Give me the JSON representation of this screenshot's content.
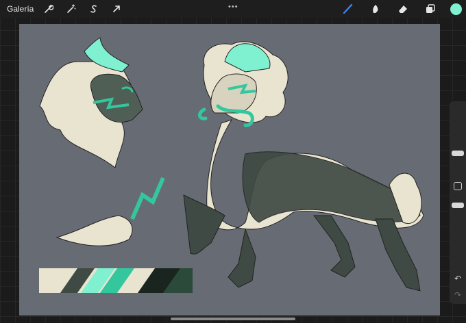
{
  "topbar": {
    "gallery_label": "Galería",
    "left_tools": [
      {
        "icon": "wrench-icon"
      },
      {
        "icon": "magic-wand-icon"
      },
      {
        "icon": "selection-s-icon"
      },
      {
        "icon": "transform-arrow-icon"
      }
    ],
    "more_dots": "•••",
    "right_tools": [
      {
        "icon": "brush-icon",
        "active": true
      },
      {
        "icon": "smudge-icon"
      },
      {
        "icon": "eraser-icon"
      },
      {
        "icon": "layers-icon"
      }
    ],
    "current_color": "#7ff0d0"
  },
  "canvas": {
    "background": "#676b74",
    "palette": [
      "#e9e4d0",
      "#3f4a44",
      "#7ff0d0",
      "#34c79e",
      "#e9e4d0",
      "#1a2520",
      "#2b4a3a"
    ]
  },
  "sidebar": {
    "undo_label": "↶",
    "redo_label": "↷"
  }
}
